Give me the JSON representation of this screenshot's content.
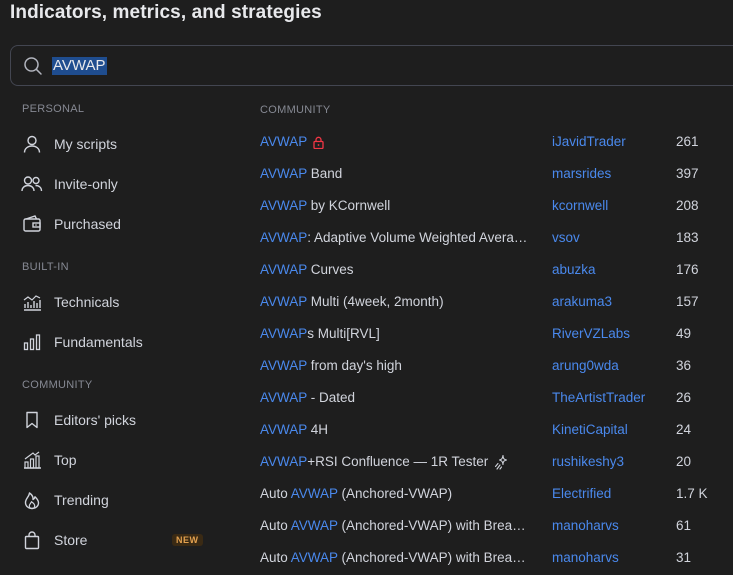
{
  "title": "Indicators, metrics, and strategies",
  "search": {
    "value": "AVWAP"
  },
  "sidebar": {
    "personal_label": "PERSONAL",
    "builtin_label": "BUILT-IN",
    "community_label": "COMMUNITY",
    "items": [
      {
        "label": "My scripts",
        "icon": "person-icon"
      },
      {
        "label": "Invite-only",
        "icon": "users-icon"
      },
      {
        "label": "Purchased",
        "icon": "wallet-icon"
      },
      {
        "label": "Technicals",
        "icon": "technicals-chart-icon"
      },
      {
        "label": "Fundamentals",
        "icon": "bar-chart-icon"
      },
      {
        "label": "Editors' picks",
        "icon": "bookmark-icon"
      },
      {
        "label": "Top",
        "icon": "rising-bars-icon"
      },
      {
        "label": "Trending",
        "icon": "flame-icon"
      },
      {
        "label": "Store",
        "icon": "shopping-bag-icon",
        "badge": "NEW"
      }
    ]
  },
  "results": {
    "section_label": "COMMUNITY",
    "rows": [
      {
        "pre": "",
        "hl": "AVWAP",
        "post": "",
        "ext": "lock",
        "author": "iJavidTrader",
        "count": "261"
      },
      {
        "pre": "",
        "hl": "AVWAP",
        "post": " Band",
        "author": "marsrides",
        "count": "397"
      },
      {
        "pre": "",
        "hl": "AVWAP",
        "post": " by KCornwell",
        "author": "kcornwell",
        "count": "208"
      },
      {
        "pre": "",
        "hl": "AVWAP",
        "post": ": Adaptive Volume Weighted Avera…",
        "author": "vsov",
        "count": "183"
      },
      {
        "pre": "",
        "hl": "AVWAP",
        "post": " Curves",
        "author": "abuzka",
        "count": "176"
      },
      {
        "pre": "",
        "hl": "AVWAP",
        "post": " Multi (4week, 2month)",
        "author": "arakuma3",
        "count": "157"
      },
      {
        "pre": "",
        "hl": "AVWAP",
        "post": "s Multi[RVL]",
        "author": "RiverVZLabs",
        "count": "49"
      },
      {
        "pre": "",
        "hl": "AVWAP",
        "post": " from day's high",
        "author": "arung0wda",
        "count": "36"
      },
      {
        "pre": "",
        "hl": "AVWAP",
        "post": " - Dated",
        "author": "TheArtistTrader",
        "count": "26"
      },
      {
        "pre": "",
        "hl": "AVWAP",
        "post": " 4H",
        "author": "KinetiCapital",
        "count": "24"
      },
      {
        "pre": "",
        "hl": "AVWAP",
        "post": "+RSI Confluence — 1R Tester",
        "ext": "sparkle",
        "author": "rushikeshy3",
        "count": "20"
      },
      {
        "pre": "Auto ",
        "hl": "AVWAP",
        "post": " (Anchored-VWAP)",
        "author": "Electrified",
        "count": "1.7 K"
      },
      {
        "pre": "Auto ",
        "hl": "AVWAP",
        "post": " (Anchored-VWAP) with Brea…",
        "author": "manoharvs",
        "count": "61"
      },
      {
        "pre": "Auto ",
        "hl": "AVWAP",
        "post": " (Anchored-VWAP) with Brea…",
        "author": "manoharvs",
        "count": "31"
      }
    ]
  },
  "colors": {
    "accent": "#4a89ed",
    "lock": "#f23645",
    "badge": "#e3a14f",
    "background": "#1e1e1e"
  }
}
